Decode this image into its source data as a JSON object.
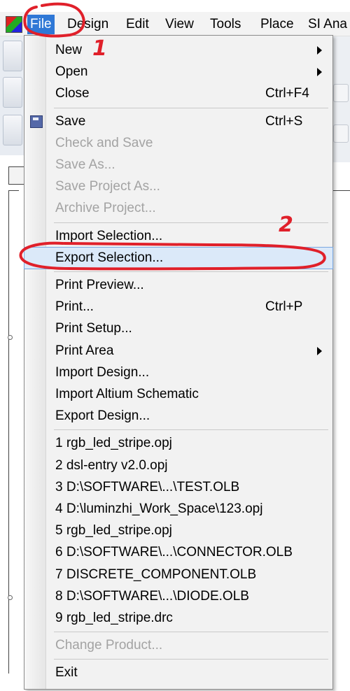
{
  "menubar": {
    "items": [
      "File",
      "Design",
      "Edit",
      "View",
      "Tools",
      "Place",
      "SI Ana"
    ]
  },
  "file_menu": {
    "groups": [
      [
        {
          "label": "New",
          "submenu": true
        },
        {
          "label": "Open",
          "submenu": true
        },
        {
          "label": "Close",
          "shortcut": "Ctrl+F4"
        }
      ],
      [
        {
          "label": "Save",
          "shortcut": "Ctrl+S",
          "icon": "save-icon"
        },
        {
          "label": "Check and Save",
          "disabled": true
        },
        {
          "label": "Save As...",
          "disabled": true
        },
        {
          "label": "Save Project As...",
          "disabled": true
        },
        {
          "label": "Archive Project...",
          "disabled": true
        }
      ],
      [
        {
          "label": "Import Selection..."
        },
        {
          "label": "Export Selection...",
          "highlighted": true
        }
      ],
      [
        {
          "label": "Print Preview..."
        },
        {
          "label": "Print...",
          "shortcut": "Ctrl+P"
        },
        {
          "label": "Print Setup..."
        },
        {
          "label": "Print Area",
          "submenu": true
        },
        {
          "label": "Import Design..."
        },
        {
          "label": "Import Altium Schematic"
        },
        {
          "label": "Export Design..."
        }
      ],
      [
        {
          "label": "1 rgb_led_stripe.opj"
        },
        {
          "label": "2 dsl-entry v2.0.opj"
        },
        {
          "label": "3 D:\\SOFTWARE\\...\\TEST.OLB"
        },
        {
          "label": "4 D:\\luminzhi_Work_Space\\123.opj"
        },
        {
          "label": "5 rgb_led_stripe.opj"
        },
        {
          "label": "6 D:\\SOFTWARE\\...\\CONNECTOR.OLB"
        },
        {
          "label": "7 DISCRETE_COMPONENT.OLB"
        },
        {
          "label": "8 D:\\SOFTWARE\\...\\DIODE.OLB"
        },
        {
          "label": "9 rgb_led_stripe.drc"
        }
      ],
      [
        {
          "label": "Change Product...",
          "disabled": true
        }
      ],
      [
        {
          "label": "Exit"
        }
      ]
    ]
  },
  "annotations": {
    "step1": "1",
    "step2": "2",
    "color": "#e0202a"
  },
  "colors": {
    "menubar_active": "#2f78d6",
    "highlight_fill": "#dbe9f9",
    "disabled_text": "#a3a3a3"
  }
}
